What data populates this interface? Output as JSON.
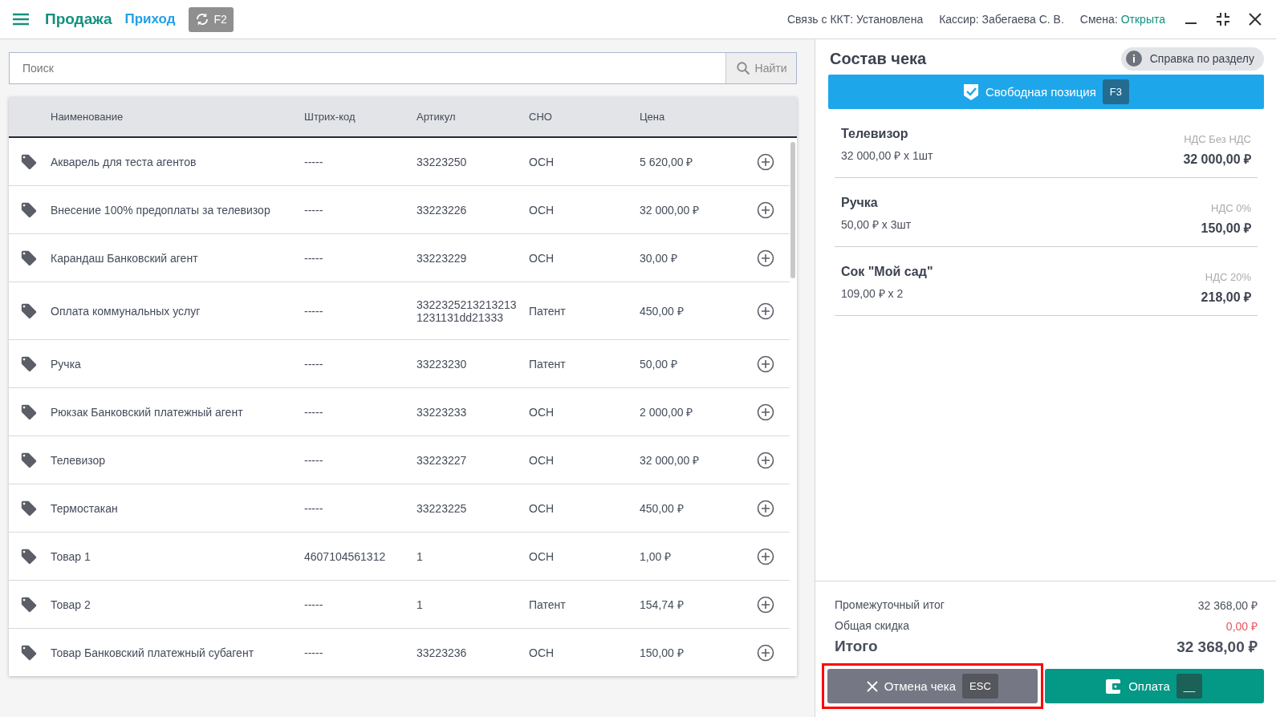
{
  "header": {
    "title": "Продажа",
    "mode": "Приход",
    "sync_key": "F2",
    "status": [
      {
        "label": "Связь с ККТ:",
        "value": "Установлена",
        "kind": "plain"
      },
      {
        "label": "Кассир:",
        "value": "Забегаева С. В.",
        "kind": "plain"
      },
      {
        "label": "Смена:",
        "value": "Открыта",
        "kind": "ok"
      }
    ]
  },
  "search": {
    "placeholder": "Поиск",
    "button": "Найти"
  },
  "table": {
    "columns": [
      "Наименование",
      "Штрих-код",
      "Артикул",
      "СНО",
      "Цена"
    ],
    "rows": [
      {
        "name": "Акварель для теста агентов",
        "barcode": "-----",
        "article": "33223250",
        "sno": "ОСН",
        "price": "5 620,00 ₽"
      },
      {
        "name": "Внесение 100% предоплаты за телевизор",
        "barcode": "-----",
        "article": "33223226",
        "sno": "ОСН",
        "price": "32 000,00 ₽"
      },
      {
        "name": "Карандаш Банковский агент",
        "barcode": "-----",
        "article": "33223229",
        "sno": "ОСН",
        "price": "30,00 ₽"
      },
      {
        "name": "Оплата коммунальных услуг",
        "barcode": "-----",
        "article": "3322325213213213 1231131dd21333",
        "sno": "Патент",
        "price": "450,00 ₽"
      },
      {
        "name": "Ручка",
        "barcode": "-----",
        "article": "33223230",
        "sno": "Патент",
        "price": "50,00 ₽"
      },
      {
        "name": "Рюкзак Банковский платежный агент",
        "barcode": "-----",
        "article": "33223233",
        "sno": "ОСН",
        "price": "2 000,00 ₽"
      },
      {
        "name": "Телевизор",
        "barcode": "-----",
        "article": "33223227",
        "sno": "ОСН",
        "price": "32 000,00 ₽"
      },
      {
        "name": "Термостакан",
        "barcode": "-----",
        "article": "33223225",
        "sno": "ОСН",
        "price": "450,00 ₽"
      },
      {
        "name": "Товар 1",
        "barcode": "4607104561312",
        "article": "1",
        "sno": "ОСН",
        "price": "1,00 ₽"
      },
      {
        "name": "Товар 2",
        "barcode": "-----",
        "article": "1",
        "sno": "Патент",
        "price": "154,74 ₽"
      },
      {
        "name": "Товар Банковский платежный субагент",
        "barcode": "-----",
        "article": "33223236",
        "sno": "ОСН",
        "price": "150,00 ₽"
      }
    ]
  },
  "receipt": {
    "title": "Состав чека",
    "help": "Справка по разделу",
    "free_item": {
      "label": "Свободная позиция",
      "key": "F3"
    },
    "items": [
      {
        "name": "Телевизор",
        "qty": "32 000,00 ₽ x 1шт",
        "vat": "НДС Без НДС",
        "total": "32 000,00 ₽"
      },
      {
        "name": "Ручка",
        "qty": "50,00 ₽ x 3шт",
        "vat": "НДС 0%",
        "total": "150,00 ₽"
      },
      {
        "name": "Сок \"Мой сад\"",
        "qty": "109,00 ₽ x 2",
        "vat": "НДС 20%",
        "total": "218,00 ₽"
      }
    ],
    "summary": [
      {
        "label": "Промежуточный итог",
        "value": "32 368,00 ₽",
        "kind": "plain"
      },
      {
        "label": "Общая скидка",
        "value": "0,00 ₽",
        "kind": "discount"
      },
      {
        "label": "Итого",
        "value": "32 368,00 ₽",
        "kind": "total"
      }
    ],
    "cancel": {
      "label": "Отмена чека",
      "key": "ESC",
      "highlighted": true
    },
    "pay": {
      "label": "Оплата",
      "key": "__"
    }
  }
}
